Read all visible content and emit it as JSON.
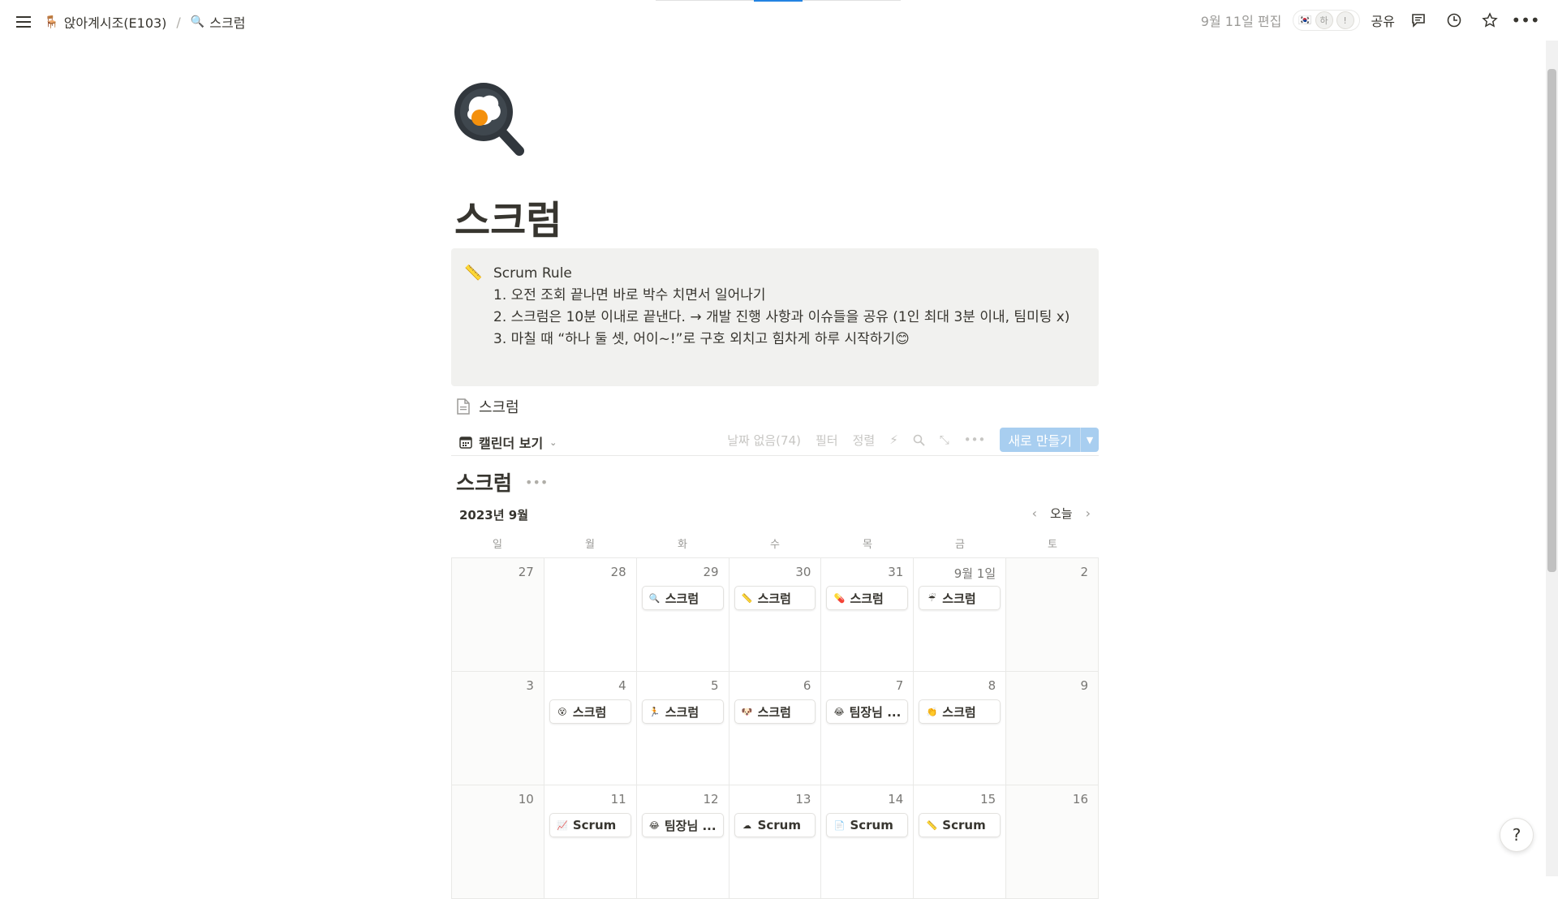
{
  "topbar": {
    "workspace": "앉아계시조(E103)",
    "page_crumb": "스크럼",
    "edited": "9월 11일 편집",
    "share": "공유",
    "avatars": [
      "하",
      "!"
    ],
    "icons": {
      "menu": "menu-icon",
      "workspace": "chair-icon",
      "comment": "comment-icon",
      "history": "clock-icon",
      "favorite": "star-icon",
      "more": "more-icon"
    }
  },
  "page": {
    "title": "스크럼",
    "icon": "frying-pan-egg-icon"
  },
  "callout": {
    "icon": "📏",
    "lines": [
      "Scrum Rule",
      "1. 오전 조회 끝나면 바로 박수 치면서 일어나기",
      "2. 스크럼은 10분 이내로 끝낸다.  → 개발 진행 사항과 이슈들을 공유 (1인 최대 3분 이내, 팀미팅 x)",
      "3. 마칠 때 “하나 둘 셋, 어이~!”로 구호 외치고 힘차게 하루 시작하기😊"
    ]
  },
  "subpage": {
    "label": "스크럼"
  },
  "view": {
    "tab": "캘린더 보기",
    "no_date": "날짜 없음(74)",
    "filter": "필터",
    "sort": "정렬",
    "new_button": "새로 만들기"
  },
  "database": {
    "title": "스크럼",
    "month": "2023년 9월",
    "today": "오늘",
    "weekdays": [
      "일",
      "월",
      "화",
      "수",
      "목",
      "금",
      "토"
    ]
  },
  "calendar": {
    "weeks": [
      [
        {
          "day": "27",
          "card": null
        },
        {
          "day": "28",
          "card": null
        },
        {
          "day": "29",
          "card": {
            "icon": "🔍",
            "label": "스크럼"
          }
        },
        {
          "day": "30",
          "card": {
            "icon": "📏",
            "label": "스크럼"
          }
        },
        {
          "day": "31",
          "card": {
            "icon": "💊",
            "label": "스크럼"
          }
        },
        {
          "day": "9월 1일",
          "card": {
            "icon": "☔",
            "label": "스크럼"
          }
        },
        {
          "day": "2",
          "card": null
        }
      ],
      [
        {
          "day": "3",
          "card": null
        },
        {
          "day": "4",
          "card": {
            "icon": "😵",
            "label": "스크럼"
          }
        },
        {
          "day": "5",
          "card": {
            "icon": "🏃",
            "label": "스크럼"
          }
        },
        {
          "day": "6",
          "card": {
            "icon": "🐶",
            "label": "스크럼"
          }
        },
        {
          "day": "7",
          "card": {
            "icon": "😂",
            "label": "팀장님 ..."
          }
        },
        {
          "day": "8",
          "card": {
            "icon": "👏",
            "label": "스크럼"
          }
        },
        {
          "day": "9",
          "card": null
        }
      ],
      [
        {
          "day": "10",
          "card": null
        },
        {
          "day": "11",
          "card": {
            "icon": "📈",
            "label": "Scrum"
          }
        },
        {
          "day": "12",
          "card": {
            "icon": "😂",
            "label": "팀장님 ..."
          }
        },
        {
          "day": "13",
          "card": {
            "icon": "☁",
            "label": "Scrum"
          }
        },
        {
          "day": "14",
          "card": {
            "icon": "📄",
            "label": "Scrum"
          }
        },
        {
          "day": "15",
          "card": {
            "icon": "📏",
            "label": "Scrum"
          }
        },
        {
          "day": "16",
          "card": null
        }
      ]
    ]
  },
  "help": "?"
}
